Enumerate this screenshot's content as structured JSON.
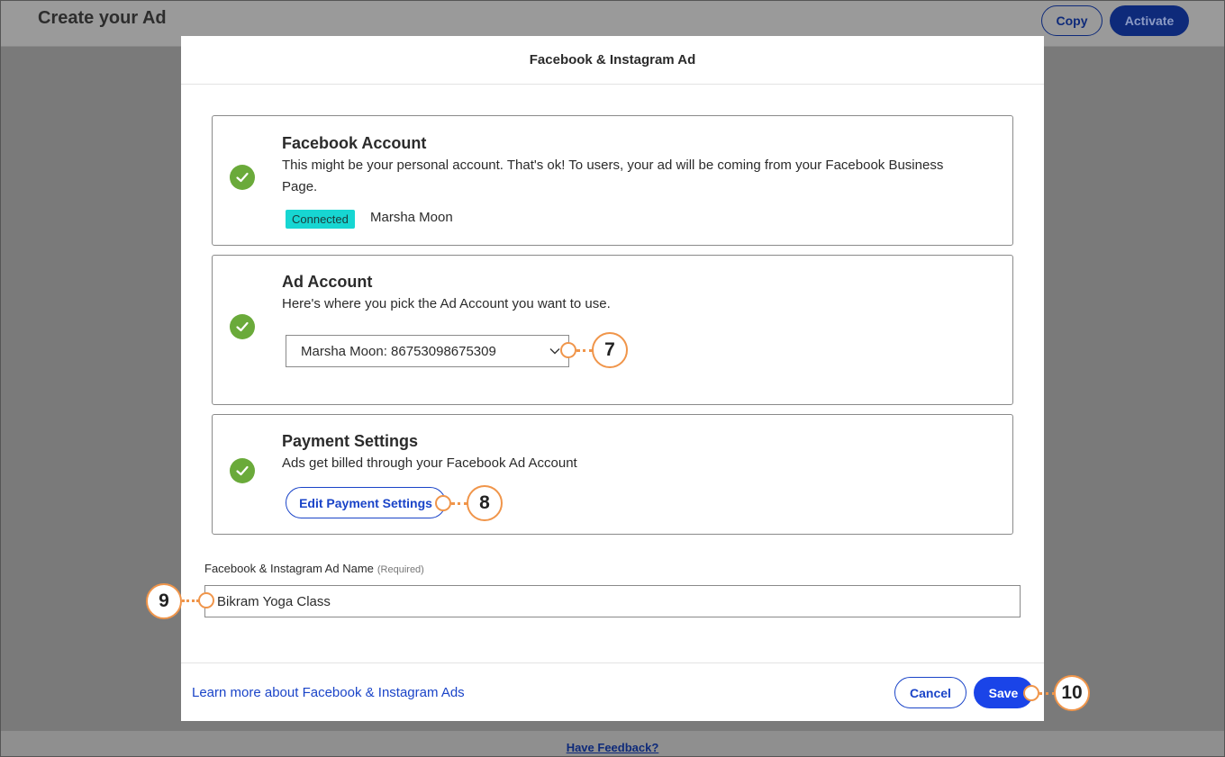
{
  "background": {
    "title": "Create your Ad",
    "copy_label": "Copy",
    "activate_label": "Activate",
    "feedback_label": "Have Feedback?"
  },
  "modal": {
    "title": "Facebook & Instagram Ad",
    "facebook_account": {
      "title": "Facebook Account",
      "description": "This might be your personal account. That's ok! To users, your ad will be coming from your Facebook Business Page.",
      "status": "Connected",
      "account_name": "Marsha Moon"
    },
    "ad_account": {
      "title": "Ad Account",
      "description": "Here's where you pick the Ad Account you want to use.",
      "selected": "Marsha Moon: 86753098675309"
    },
    "payment_settings": {
      "title": "Payment Settings",
      "description": "Ads get billed through your Facebook Ad Account",
      "edit_label": "Edit Payment Settings"
    },
    "ad_name": {
      "label": "Facebook & Instagram Ad Name",
      "required": "(Required)",
      "value": "Bikram Yoga Class"
    },
    "footer": {
      "learn_more": "Learn more about Facebook & Instagram Ads",
      "cancel_label": "Cancel",
      "save_label": "Save"
    }
  },
  "callouts": {
    "c7": "7",
    "c8": "8",
    "c9": "9",
    "c10": "10"
  },
  "colors": {
    "accent": "#1a44c8",
    "save": "#1a44e8",
    "success": "#6aaa3a",
    "badge": "#17d6d2",
    "callout": "#f0954a"
  }
}
